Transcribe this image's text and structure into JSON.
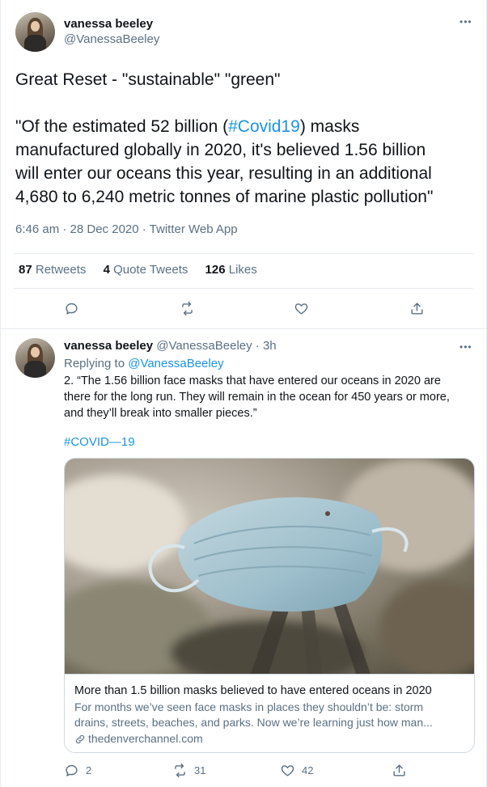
{
  "main_tweet": {
    "display_name": "vanessa beeley",
    "handle": "@VanessaBeeley",
    "more_icon": "more-dots-icon",
    "text_line1": "Great Reset - \"sustainable\" \"green\"",
    "text_p2_before": "\"Of the estimated 52 billion (",
    "hashtag": "#Covid19",
    "text_p2_after": ") masks",
    "text_p2_line2": "manufactured globally in 2020, it's believed 1.56 billion",
    "text_p2_line3": "will enter our oceans this year, resulting in an additional",
    "text_p2_line4": "4,680 to 6,240 metric tonnes of marine plastic pollution\"",
    "timestamp": "6:46 am · 28 Dec 2020 · Twitter Web App",
    "stats": {
      "retweets_count": "87",
      "retweets_label": "Retweets",
      "quote_count": "4",
      "quote_label": "Quote Tweets",
      "likes_count": "126",
      "likes_label": "Likes"
    }
  },
  "reply_tweet": {
    "display_name": "vanessa beeley",
    "handle_time": "@VanessaBeeley · 3h",
    "replying_prefix": "Replying to",
    "replying_handle": "@VanessaBeeley",
    "text_line1": "2. “The 1.56 billion face masks that have entered our oceans in 2020 are",
    "text_line2": "there for the long run. They will remain in the ocean for 450 years or more,",
    "text_line3": "and they’ll break into smaller pieces.”",
    "hashtag": "#COVID—19",
    "card": {
      "title": "More than 1.5 billion masks believed to have entered oceans in 2020",
      "desc_line1": "For months we’ve seen face masks in places they shouldn’t be: storm",
      "desc_line2": "drains, streets, beaches, and parks. Now we’re learning just how man...",
      "domain": "thedenverchannel.com"
    },
    "actions": {
      "reply_count": "2",
      "retweet_count": "31",
      "like_count": "42"
    }
  },
  "colors": {
    "link": "#1b95e0",
    "muted": "#5b7083",
    "border": "#e6ecf0"
  }
}
